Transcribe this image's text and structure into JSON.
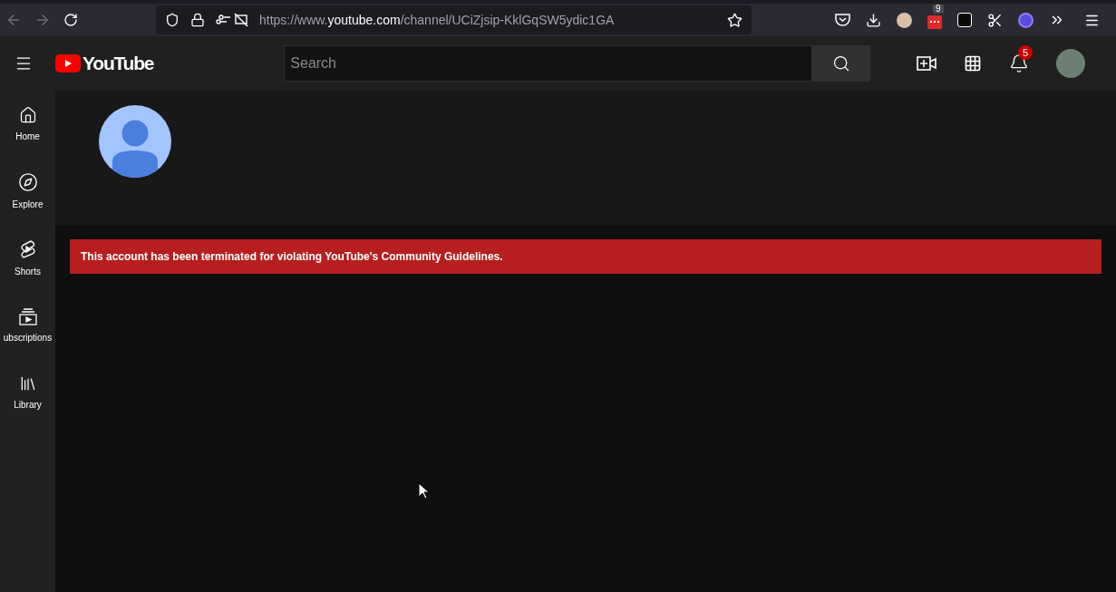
{
  "browser": {
    "url": {
      "prefix": "https://www.",
      "host": "youtube.com",
      "path": "/channel/UCiZjsip-KklGqSW5ydic1GA"
    },
    "extension_badge": "9"
  },
  "header": {
    "logo": "YouTube",
    "search": {
      "placeholder": "Search"
    },
    "notification_count": "5"
  },
  "sidebar": {
    "items": [
      {
        "label": "Home",
        "selected": false
      },
      {
        "label": "Explore",
        "selected": false
      },
      {
        "label": "Shorts",
        "selected": false
      },
      {
        "label": "ubscriptions",
        "selected": false
      },
      {
        "label": "Library",
        "selected": false
      }
    ]
  },
  "alert": {
    "message": "This account has been terminated for violating YouTube's Community Guidelines."
  }
}
